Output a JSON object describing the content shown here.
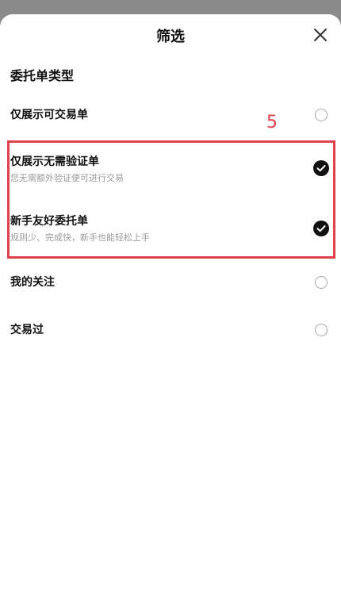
{
  "header": {
    "title": "筛选"
  },
  "section": {
    "title": "委托单类型"
  },
  "options": [
    {
      "label": "仅展示可交易单",
      "sub": "",
      "selected": false
    },
    {
      "label": "仅展示无需验证单",
      "sub": "您无需额外验证便可进行交易",
      "selected": true
    },
    {
      "label": "新手友好委托单",
      "sub": "规则少、完成快，新手也能轻松上手",
      "selected": true
    },
    {
      "label": "我的关注",
      "sub": "",
      "selected": false
    },
    {
      "label": "交易过",
      "sub": "",
      "selected": false
    }
  ],
  "annotation": {
    "number": "5",
    "color": "#e0424d"
  },
  "colors": {
    "overlay": "#8a8a8a",
    "sheet": "#ffffff",
    "check": "#111111"
  }
}
